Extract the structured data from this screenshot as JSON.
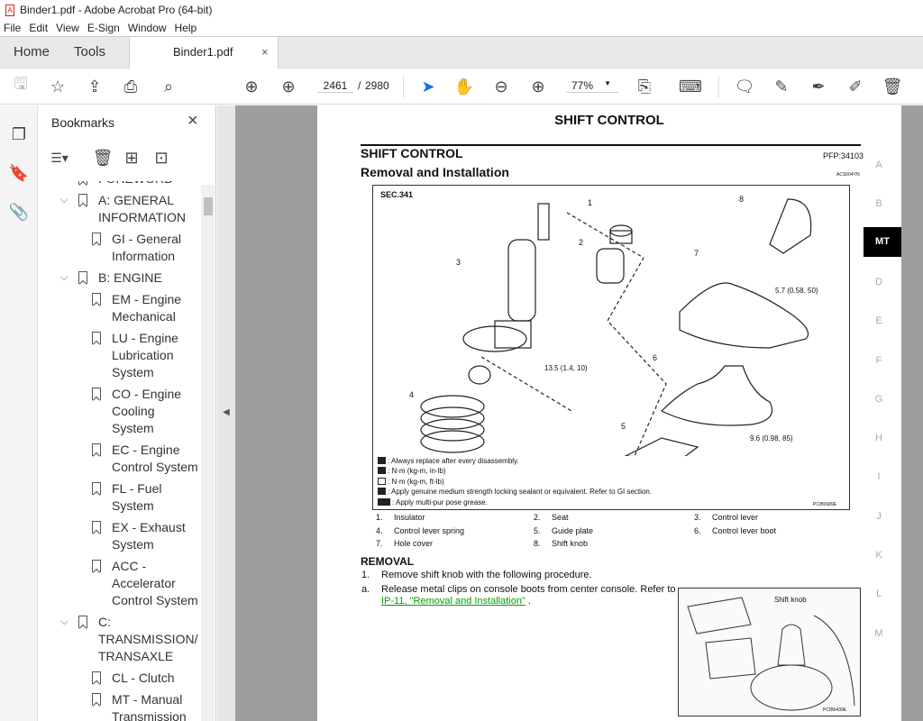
{
  "window": {
    "title": "Binder1.pdf - Adobe Acrobat Pro (64-bit)"
  },
  "menu": [
    "File",
    "Edit",
    "View",
    "E-Sign",
    "Window",
    "Help"
  ],
  "tabs": {
    "home": "Home",
    "tools": "Tools",
    "document": "Binder1.pdf",
    "close": "×"
  },
  "toolbar": {
    "current_page": "2461",
    "separator": "/",
    "total_pages": "2980",
    "zoom": "77%"
  },
  "bookmarks": {
    "title": "Bookmarks",
    "items": [
      {
        "label": "FOREWORD",
        "level": 1,
        "expanded": null
      },
      {
        "label": "A: GENERAL INFORMATION",
        "level": 1,
        "expanded": true
      },
      {
        "label": "GI - General Information",
        "level": 2
      },
      {
        "label": "B: ENGINE",
        "level": 1,
        "expanded": true
      },
      {
        "label": "EM - Engine Mechanical",
        "level": 2
      },
      {
        "label": "LU - Engine Lubrication System",
        "level": 2
      },
      {
        "label": "CO - Engine Cooling System",
        "level": 2
      },
      {
        "label": "EC - Engine Control System",
        "level": 2
      },
      {
        "label": "FL - Fuel System",
        "level": 2
      },
      {
        "label": "EX - Exhaust System",
        "level": 2
      },
      {
        "label": "ACC - Accelerator Control System",
        "level": 2
      },
      {
        "label": "C: TRANSMISSION/TRANSAXLE",
        "level": 1,
        "expanded": true
      },
      {
        "label": "CL - Clutch",
        "level": 2
      },
      {
        "label": "MT - Manual Transmission",
        "level": 2
      }
    ]
  },
  "page": {
    "header": "SHIFT CONTROL",
    "section_title": "SHIFT CONTROL",
    "pfp": "PFP:34103",
    "subtitle": "Removal and Installation",
    "code": "ACS004YN",
    "diagram": {
      "sec": "SEC.341",
      "callouts": [
        "1",
        "2",
        "3",
        "4",
        "5",
        "6",
        "7",
        "8"
      ],
      "torques": [
        "5.7 (0.58, 50)",
        "13.5 (1.4, 10)",
        "9.6 (0.98, 85)"
      ],
      "legend": [
        ": Always replace after every disassembly.",
        ": N·m (kg-m, in-lb)",
        ": N·m (kg-m, ft-lb)",
        ": Apply genuine medium strength locking sealant or equivalent. Refer to GI section.",
        ": Apply multi-pur pose grease."
      ],
      "figure_id": "PCIB0689E"
    },
    "parts": [
      {
        "n": "1.",
        "name": "Insulator"
      },
      {
        "n": "2.",
        "name": "Seat"
      },
      {
        "n": "3.",
        "name": "Control lever"
      },
      {
        "n": "4.",
        "name": "Control lever spring"
      },
      {
        "n": "5.",
        "name": "Guide plate"
      },
      {
        "n": "6.",
        "name": "Control lever boot"
      },
      {
        "n": "7.",
        "name": "Hole cover"
      },
      {
        "n": "8.",
        "name": "Shift knob"
      }
    ],
    "removal_heading": "REMOVAL",
    "steps": [
      {
        "n": "1.",
        "text": "Remove shift knob with the following procedure."
      },
      {
        "n": "a.",
        "text": "Release metal clips on console boots from center console. Refer to ",
        "link": "IP-11, \"Removal and Installation\"",
        "after": " ."
      }
    ],
    "photo": {
      "label": "Shift knob",
      "figure_id": "PCIB0439E"
    },
    "side_tabs": [
      "A",
      "B",
      "MT",
      "D",
      "E",
      "F",
      "G",
      "H",
      "I",
      "J",
      "K",
      "L",
      "M"
    ],
    "active_side_tab": "MT"
  },
  "colors": {
    "accent": "#1473e6",
    "link": "#00a000",
    "active_tab": "#000000"
  }
}
